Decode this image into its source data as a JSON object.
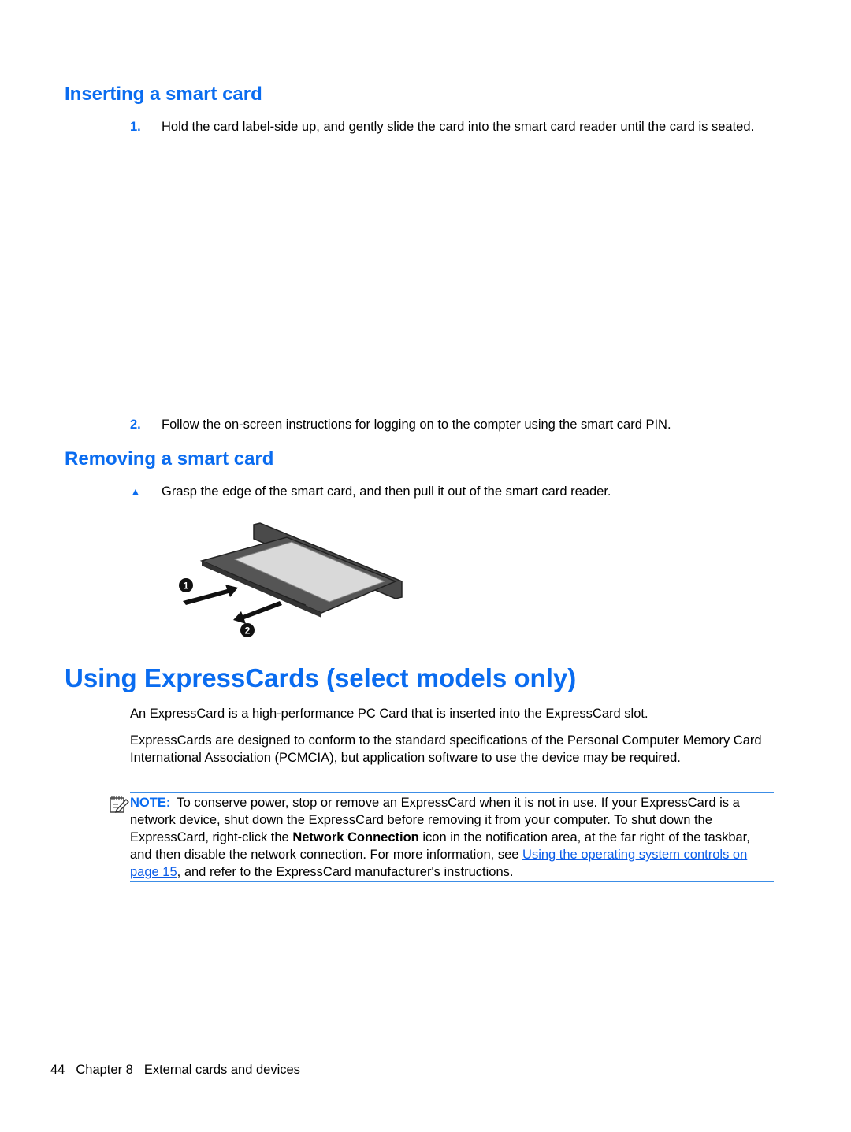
{
  "sections": {
    "inserting": {
      "heading": "Inserting a smart card",
      "steps": [
        {
          "number": "1.",
          "text": "Hold the card label-side up, and gently slide the card into the smart card reader until the card is seated."
        },
        {
          "number": "2.",
          "text": "Follow the on-screen instructions for logging on to the compter using the smart card PIN."
        }
      ]
    },
    "removing": {
      "heading": "Removing a smart card",
      "bullet_icon": "triangle-up-icon",
      "bullet_glyph": "▲",
      "step_text": "Grasp the edge of the smart card, and then pull it out of the smart card reader.",
      "figure": {
        "callouts": [
          "1",
          "2"
        ]
      }
    },
    "expresscards": {
      "heading": "Using ExpressCards (select models only)",
      "paragraphs": [
        "An ExpressCard is a high-performance PC Card that is inserted into the ExpressCard slot.",
        "ExpressCards are designed to conform to the standard specifications of the Personal Computer Memory Card International Association (PCMCIA), but application software to use the device may be required."
      ],
      "note": {
        "icon": "note-pencil-icon",
        "label": "NOTE:",
        "text_1": "To conserve power, stop or remove an ExpressCard when it is not in use. If your ExpressCard is a network device, shut down the ExpressCard before removing it from your computer. To shut down the ExpressCard, right-click the ",
        "bold": "Network Connection",
        "text_2": " icon in the notification area, at the far right of the taskbar, and then disable the network connection. For more information, see ",
        "link": "Using the operating system controls on page 15",
        "text_3": ", and refer to the ExpressCard manufacturer's instructions."
      }
    }
  },
  "footer": {
    "page_number": "44",
    "chapter": "Chapter 8",
    "chapter_title": "External cards and devices"
  },
  "colors": {
    "heading": "#0a6cf0",
    "link": "#0a5ce8",
    "rule": "#3c8de6"
  }
}
